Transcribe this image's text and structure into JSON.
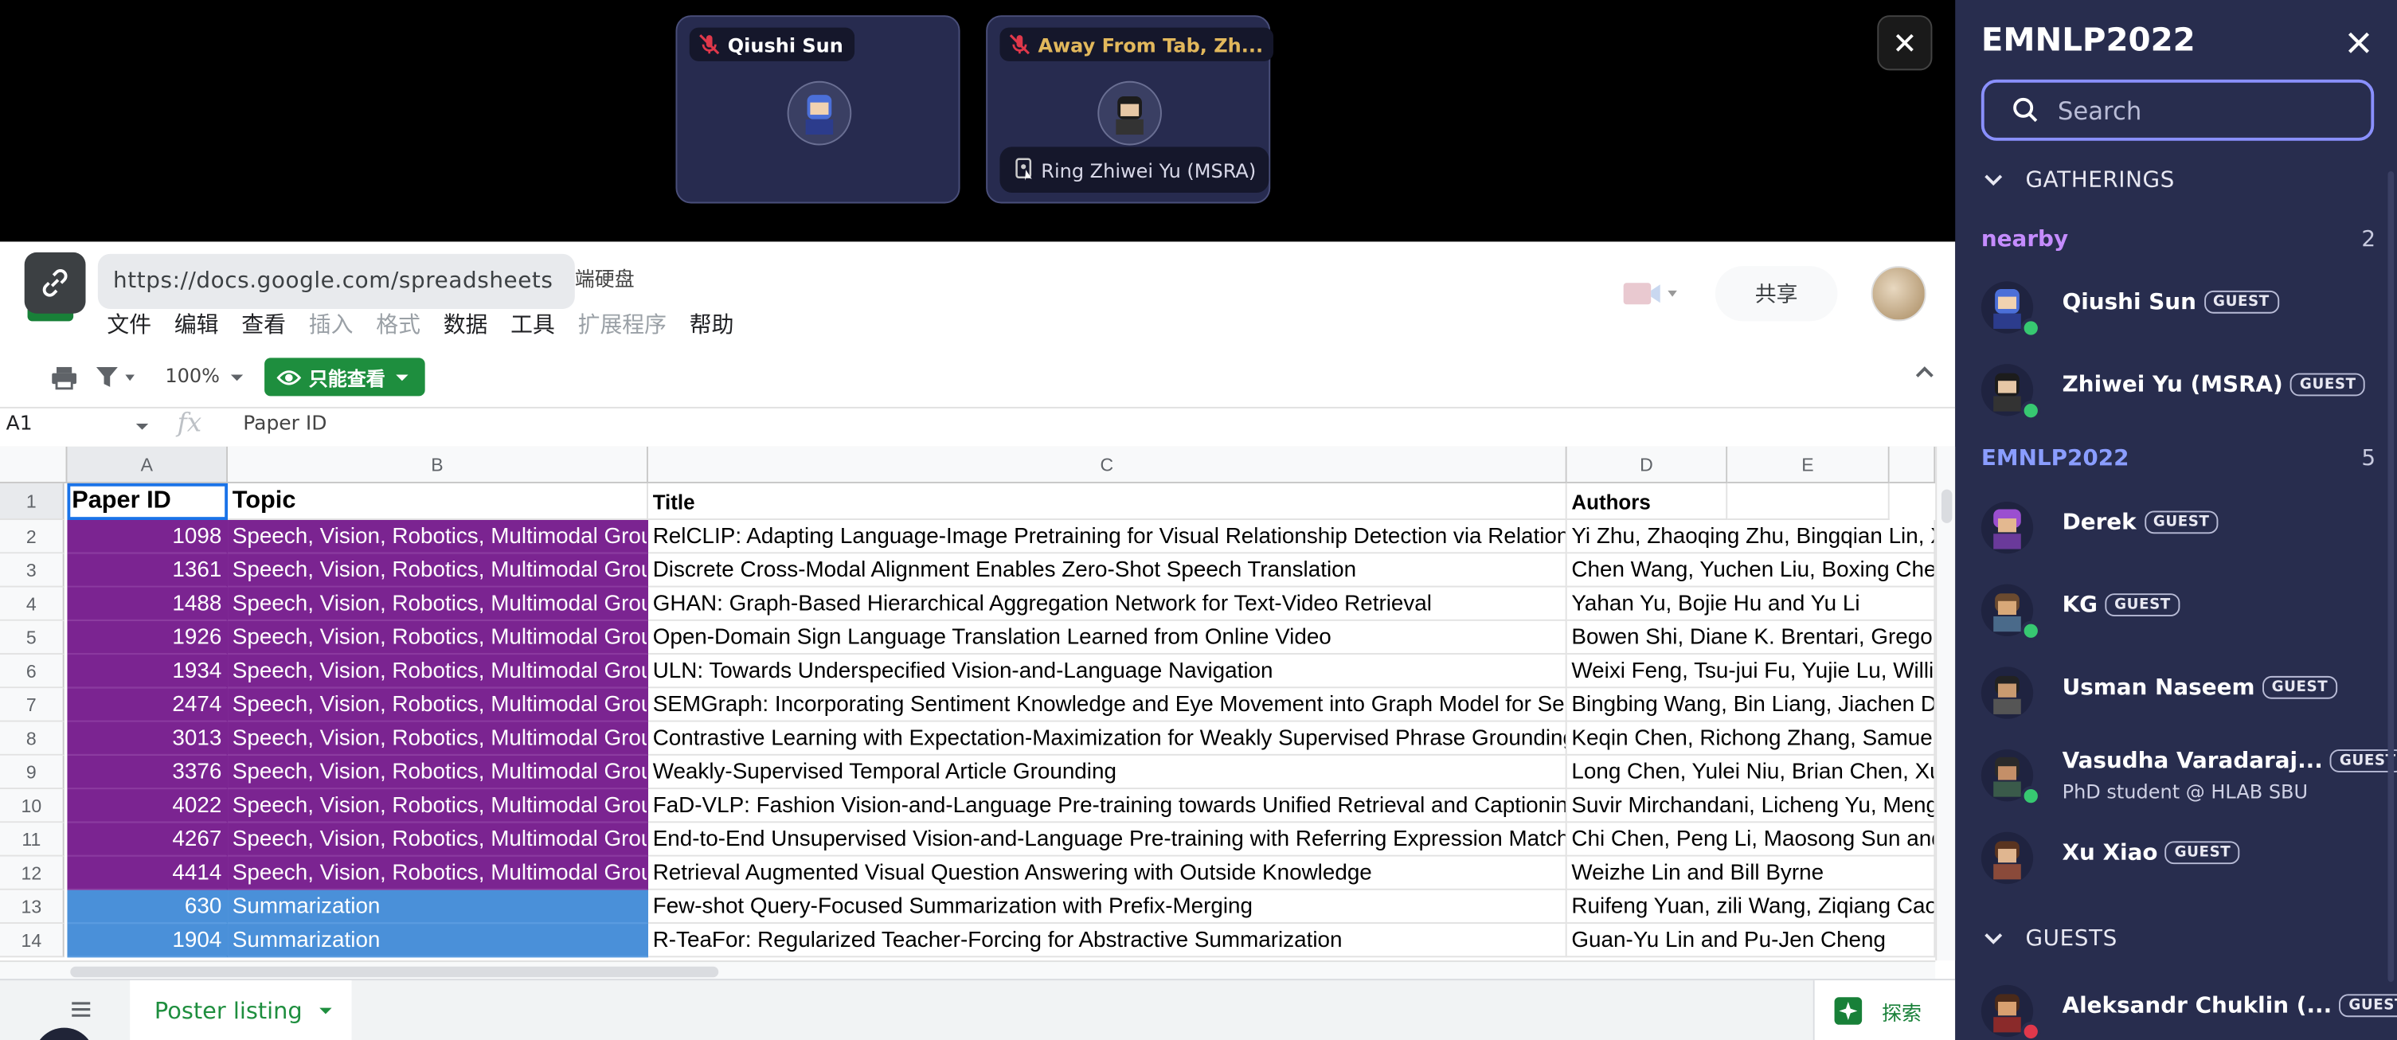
{
  "video": {
    "tiles": [
      {
        "name": "Qiushi Sun",
        "name_color": "#ffffff"
      },
      {
        "name": "Away From Tab, Zh...",
        "name_color": "#e2b85c",
        "ring_label": "Ring Zhiwei Yu (MSRA)"
      }
    ]
  },
  "sheets": {
    "url": "https://docs.google.com/spreadsheets",
    "drive_label": "端硬盘",
    "menu": [
      "文件",
      "编辑",
      "查看",
      "插入",
      "格式",
      "数据",
      "工具",
      "扩展程序",
      "帮助"
    ],
    "share_label": "共享",
    "zoom": "100%",
    "view_mode_label": "只能查看",
    "name_box": "A1",
    "formula_value": "Paper ID",
    "column_headers": [
      "A",
      "B",
      "C",
      "D",
      "E"
    ],
    "header_row": {
      "a": "Paper ID",
      "b": "Topic",
      "c": "Title",
      "d": "Authors"
    },
    "rows": [
      {
        "num": "2",
        "id": "1098",
        "topic": "Speech, Vision, Robotics, Multimodal Groun",
        "title": "RelCLIP: Adapting Language-Image Pretraining for Visual Relationship Detection via Relational C",
        "authors": "Yi Zhu, Zhaoqing Zhu, Bingqian Lin, Xi"
      },
      {
        "num": "3",
        "id": "1361",
        "topic": "Speech, Vision, Robotics, Multimodal Groun",
        "title": "Discrete Cross-Modal Alignment Enables Zero-Shot Speech Translation",
        "authors": "Chen Wang, Yuchen Liu, Boxing Chen"
      },
      {
        "num": "4",
        "id": "1488",
        "topic": "Speech, Vision, Robotics, Multimodal Groun",
        "title": "GHAN: Graph-Based Hierarchical Aggregation Network for Text-Video Retrieval",
        "authors": "Yahan Yu, Bojie Hu and Yu Li"
      },
      {
        "num": "5",
        "id": "1926",
        "topic": "Speech, Vision, Robotics, Multimodal Groun",
        "title": "Open-Domain Sign Language Translation Learned from Online Video",
        "authors": "Bowen Shi, Diane K. Brentari, Gregory"
      },
      {
        "num": "6",
        "id": "1934",
        "topic": "Speech, Vision, Robotics, Multimodal Groun",
        "title": "ULN: Towards Underspecified Vision-and-Language Navigation",
        "authors": "Weixi Feng, Tsu-jui Fu, Yujie Lu, Williar"
      },
      {
        "num": "7",
        "id": "2474",
        "topic": "Speech, Vision, Robotics, Multimodal Groun",
        "title": "SEMGraph: Incorporating Sentiment Knowledge and Eye Movement into Graph Model for Sentim",
        "authors": "Bingbing Wang, Bin Liang, Jiachen Du"
      },
      {
        "num": "8",
        "id": "3013",
        "topic": "Speech, Vision, Robotics, Multimodal Groun",
        "title": "Contrastive Learning with Expectation-Maximization for Weakly Supervised Phrase Grounding",
        "authors": "Keqin Chen, Richong Zhang, Samuel M"
      },
      {
        "num": "9",
        "id": "3376",
        "topic": "Speech, Vision, Robotics, Multimodal Groun",
        "title": "Weakly-Supervised Temporal Article Grounding",
        "authors": "Long Chen, Yulei Niu, Brian Chen, Xuc"
      },
      {
        "num": "10",
        "id": "4022",
        "topic": "Speech, Vision, Robotics, Multimodal Groun",
        "title": "FaD-VLP: Fashion Vision-and-Language Pre-training towards Unified Retrieval and Captioning",
        "authors": "Suvir Mirchandani, Licheng Yu, Mengjia"
      },
      {
        "num": "11",
        "id": "4267",
        "topic": "Speech, Vision, Robotics, Multimodal Groun",
        "title": "End-to-End Unsupervised Vision-and-Language Pre-training with Referring Expression Matching",
        "authors": "Chi Chen, Peng Li, Maosong Sun and Y"
      },
      {
        "num": "12",
        "id": "4414",
        "topic": "Speech, Vision, Robotics, Multimodal Groun",
        "title": "Retrieval Augmented Visual Question Answering with Outside Knowledge",
        "authors": "Weizhe Lin and Bill Byrne"
      },
      {
        "num": "13",
        "id": "630",
        "topic": "Summarization",
        "title": "Few-shot Query-Focused Summarization with Prefix-Merging",
        "authors": "Ruifeng Yuan, zili Wang, Ziqiang Cao a"
      },
      {
        "num": "14",
        "id": "1904",
        "topic": "Summarization",
        "title": "R-TeaFor: Regularized Teacher-Forcing for Abstractive Summarization",
        "authors": "Guan-Yu Lin and Pu-Jen Cheng"
      }
    ],
    "topic_colors": {
      "Speech, Vision, Robotics, Multimodal Groun": "#7b2491",
      "Summarization": "#4a90d9"
    },
    "sheet_tab": "Poster listing",
    "explore_label": "探索"
  },
  "sidebar": {
    "title": "EMNLP2022",
    "search_placeholder": "Search",
    "gatherings_label": "GATHERINGS",
    "nearby": {
      "label": "nearby",
      "count": "2",
      "color": "#c58cff"
    },
    "nearby_people": [
      {
        "name": "Qiushi Sun",
        "badge": "GUEST"
      },
      {
        "name": "Zhiwei Yu (MSRA)",
        "badge": "GUEST"
      }
    ],
    "group": {
      "label": "EMNLP2022",
      "count": "5",
      "color": "#8a9dff"
    },
    "group_people": [
      {
        "name": "Derek",
        "badge": "GUEST"
      },
      {
        "name": "KG",
        "badge": "GUEST"
      },
      {
        "name": "Usman Naseem",
        "badge": "GUEST"
      },
      {
        "name": "Vasudha Varadaraj...",
        "badge": "GUEST",
        "subtitle": "PhD student @ HLAB SBU"
      },
      {
        "name": "Xu Xiao",
        "badge": "GUEST"
      }
    ],
    "guests_label": "GUESTS",
    "guests": [
      {
        "name": "Aleksandr Chuklin (...",
        "badge": "GUEST"
      }
    ]
  }
}
